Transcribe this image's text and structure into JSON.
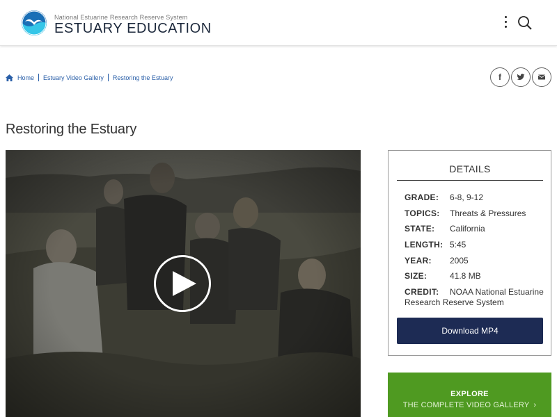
{
  "header": {
    "org_name": "National Estuarine Research Reserve System",
    "site_title": "ESTUARY EDUCATION"
  },
  "breadcrumb": {
    "items": [
      "Home",
      "Estuary Video Gallery",
      "Restoring the Estuary"
    ]
  },
  "share": {
    "facebook_glyph": "f",
    "icons": [
      "facebook-icon",
      "twitter-icon",
      "email-icon"
    ]
  },
  "page": {
    "title": "Restoring the Estuary"
  },
  "details": {
    "heading": "DETAILS",
    "rows": [
      {
        "label": "GRADE:",
        "value": "6-8, 9-12"
      },
      {
        "label": "TOPICS:",
        "value": "Threats & Pressures"
      },
      {
        "label": "STATE:",
        "value": "California"
      },
      {
        "label": "LENGTH:",
        "value": "5:45"
      },
      {
        "label": "YEAR:",
        "value": "2005"
      },
      {
        "label": "SIZE:",
        "value": "41.8 MB"
      },
      {
        "label": "CREDIT:",
        "value": "NOAA National Estuarine Research Reserve System"
      }
    ],
    "download_label": "Download MP4"
  },
  "explore": {
    "line1": "EXPLORE",
    "line2": "THE COMPLETE VIDEO GALLERY"
  },
  "colors": {
    "link": "#2a5fa8",
    "download_bg": "#1d2b54",
    "explore_bg": "#4f9a21"
  }
}
